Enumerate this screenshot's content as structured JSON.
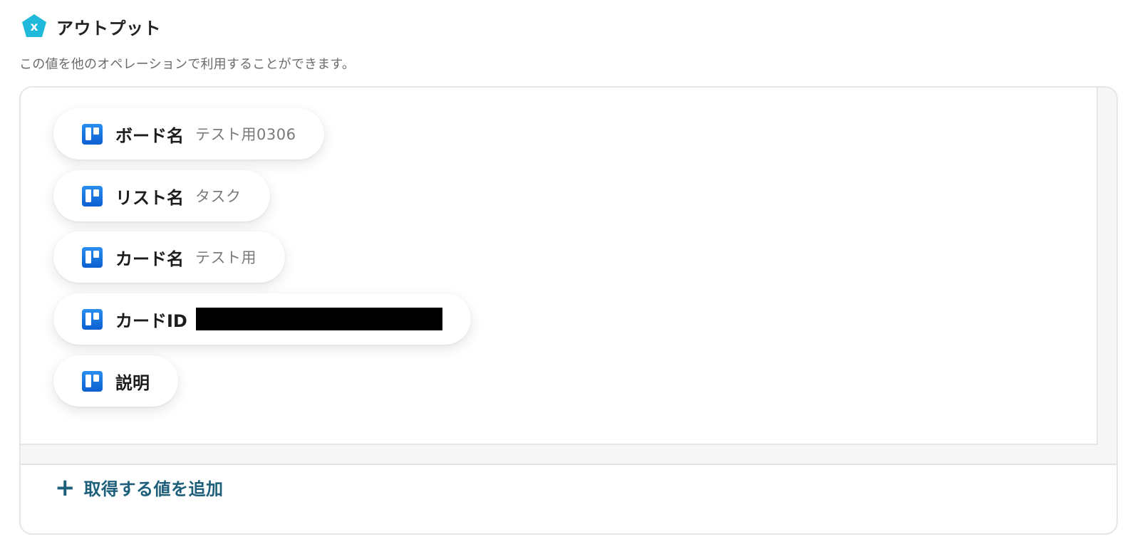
{
  "header": {
    "icon_name": "x-variable-icon",
    "icon_letter": "x",
    "icon_color": "#1fb9dc",
    "title": "アウトプット"
  },
  "subtitle": "この値を他のオペレーションで利用することができます。",
  "outputs": [
    {
      "icon": "trello-icon",
      "label": "ボード名",
      "value": "テスト用0306"
    },
    {
      "icon": "trello-icon",
      "label": "リスト名",
      "value": "タスク"
    },
    {
      "icon": "trello-icon",
      "label": "カード名",
      "value": "テスト用"
    },
    {
      "icon": "trello-icon",
      "label": "カードID",
      "value": ""
    },
    {
      "icon": "trello-icon",
      "label": "説明",
      "value": ""
    }
  ],
  "add_button": {
    "icon": "plus-icon",
    "label": "取得する値を追加"
  },
  "colors": {
    "accent": "#1d5f7a",
    "trello_blue": "#0c66e4"
  }
}
